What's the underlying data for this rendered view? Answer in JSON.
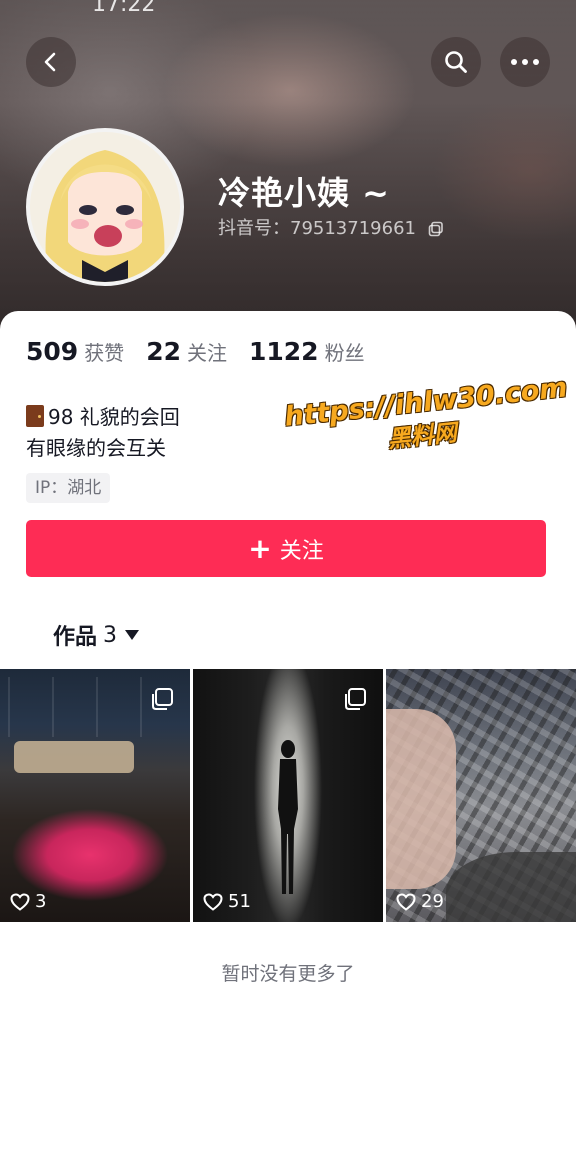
{
  "status_bar": {
    "time": "17:22"
  },
  "header": {
    "back_icon": "chevron-left-icon",
    "search_icon": "search-icon",
    "more_icon": "more-horizontal-icon"
  },
  "profile": {
    "nickname": "冷艳小姨 ~",
    "douyin_id": "抖音号：79513719661",
    "copy_icon": "copy-icon"
  },
  "stats": [
    {
      "value": "509",
      "label": "获赞"
    },
    {
      "value": "22",
      "label": "关注"
    },
    {
      "value": "1122",
      "label": "粉丝"
    }
  ],
  "bio": {
    "line1": "98 礼貌的会回",
    "line2": "有眼缘的会互关",
    "emoji": "door-icon"
  },
  "ip_tag": "IP：湖北",
  "watermark": {
    "line1": "https://ihlw30.com",
    "line2": "黑料网"
  },
  "follow_button": {
    "label": "关注",
    "plus": "+"
  },
  "works_tab": {
    "label": "作品",
    "count": "3"
  },
  "posts": [
    {
      "likes": "3"
    },
    {
      "likes": "51"
    },
    {
      "likes": "29"
    }
  ],
  "footer_note": "暂时没有更多了",
  "colors": {
    "accent": "#fe2c55",
    "watermark": "#f7a91f"
  }
}
